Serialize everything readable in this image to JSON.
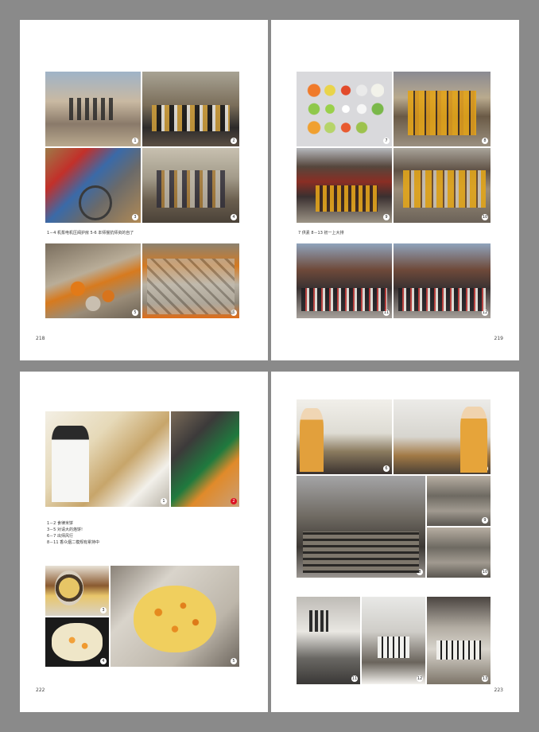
{
  "pages": [
    {
      "page_number": "218",
      "caption": "1－4 机泵电机压阀护房  5-6 本师猴抗师资的自了",
      "photo_numbers": [
        "1",
        "2",
        "3",
        "4",
        "5",
        "6"
      ]
    },
    {
      "page_number": "219",
      "caption": "7 供素  8－13 初一上大排",
      "photo_numbers": [
        "7",
        "8",
        "9",
        "10",
        "11",
        "12"
      ]
    },
    {
      "page_number": "222",
      "caption_lines": [
        "1－2 食律米饼",
        "3－5 对请大的烙饼!",
        "6－7 出师风行",
        "8－11 香众烟二模规有累持中"
      ],
      "photo_numbers": [
        "1",
        "2",
        "3",
        "4",
        "5"
      ]
    },
    {
      "page_number": "223",
      "photo_numbers": [
        "6",
        "7",
        "8",
        "9",
        "10",
        "11",
        "12",
        "13",
        "14"
      ]
    }
  ],
  "colors": {
    "background": "#8a8a8a",
    "page": "#ffffff",
    "badge_red": "#dd1122"
  }
}
